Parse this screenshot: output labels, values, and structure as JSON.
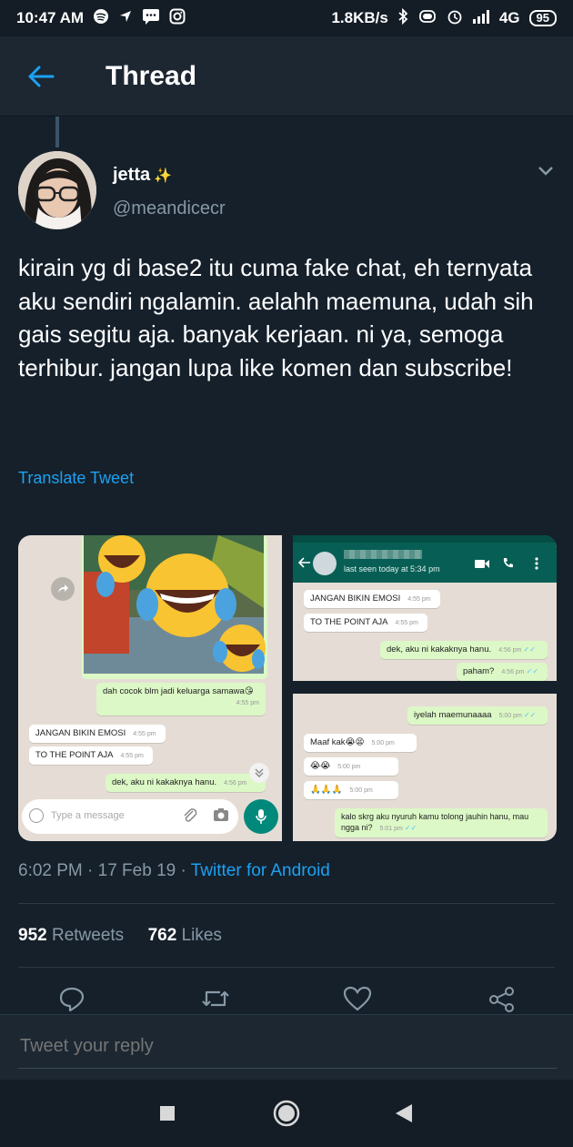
{
  "status_bar": {
    "time": "10:47 AM",
    "speed": "1.8KB/s",
    "network": "4G",
    "battery": "95"
  },
  "header": {
    "title": "Thread"
  },
  "tweet": {
    "author_name": "jetta",
    "author_handle": "@meandicecr",
    "text": "kirain yg di base2 itu cuma fake chat, eh ternyata aku sendiri ngalamin. aelahh maemuna, udah sih gais segitu aja. banyak kerjaan. ni ya, semoga terhibur. jangan lupa like komen dan subscribe!",
    "translate_label": "Translate Tweet",
    "timestamp": "6:02 PM · 17 Feb 19 · ",
    "source": "Twitter for Android",
    "retweets_count": "952",
    "retweets_label": "Retweets",
    "likes_count": "762",
    "likes_label": "Likes"
  },
  "media": {
    "left": {
      "caption": "dah cocok blm jadi keluarga samawa😘",
      "caption_time": "4:55 pm",
      "messages": [
        {
          "text": "JANGAN BIKIN EMOSI",
          "time": "4:55 pm"
        },
        {
          "text": "TO THE POINT AJA",
          "time": "4:55 pm"
        },
        {
          "text": "dek, aku ni kakaknya hanu.",
          "time": "4:56 pm"
        }
      ],
      "input_placeholder": "Type a message"
    },
    "top_right": {
      "last_seen": "last seen today at 5:34 pm",
      "messages": [
        {
          "text": "JANGAN BIKIN EMOSI",
          "time": "4:55 pm"
        },
        {
          "text": "TO THE POINT AJA",
          "time": "4:55 pm"
        },
        {
          "text": "dek, aku ni kakaknya hanu.",
          "time": "4:56 pm"
        },
        {
          "text": "paham?",
          "time": "4:56 pm"
        }
      ]
    },
    "bottom_right": {
      "messages": [
        {
          "text": "iyelah maemunaaaa",
          "time": "5:00 pm"
        },
        {
          "text": "Maaf kak😭😫",
          "time": "5:00 pm"
        },
        {
          "text": "😭😭",
          "time": "5:00 pm"
        },
        {
          "text": "🙏🙏🙏",
          "time": "5:00 pm"
        },
        {
          "text": "kalo skrg aku nyuruh kamu tolong jauhin hanu, mau ngga ni?",
          "time": "5:01 pm"
        }
      ]
    }
  },
  "reply": {
    "placeholder": "Tweet your reply"
  },
  "colors": {
    "background": "#15202b",
    "accent": "#1da1f2",
    "secondary_text": "#8899a6",
    "whatsapp_green": "#075e54"
  }
}
